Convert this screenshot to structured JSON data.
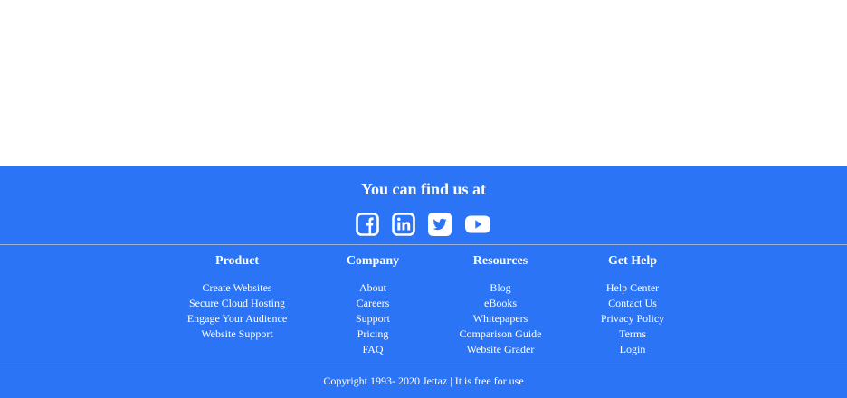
{
  "footer": {
    "heading": "You can find us at",
    "social": [
      {
        "icon": "facebook-icon"
      },
      {
        "icon": "linkedin-icon"
      },
      {
        "icon": "twitter-icon"
      },
      {
        "icon": "youtube-icon"
      }
    ],
    "columns": [
      {
        "title": "Product",
        "links": [
          "Create Websites",
          "Secure Cloud Hosting",
          "Engage Your Audience",
          "Website Support"
        ]
      },
      {
        "title": "Company",
        "links": [
          "About",
          "Careers",
          "Support",
          "Pricing",
          "FAQ"
        ]
      },
      {
        "title": "Resources",
        "links": [
          "Blog",
          "eBooks",
          "Whitepapers",
          "Comparison Guide",
          "Website Grader"
        ]
      },
      {
        "title": "Get Help",
        "links": [
          "Help Center",
          "Contact Us",
          "Privacy Policy",
          "Terms",
          "Login"
        ]
      }
    ],
    "copyright": "Copyright 1993- 2020 Jettaz | It is free for use"
  },
  "colors": {
    "footer_bg": "#2b74f6",
    "text": "#ffffff"
  }
}
